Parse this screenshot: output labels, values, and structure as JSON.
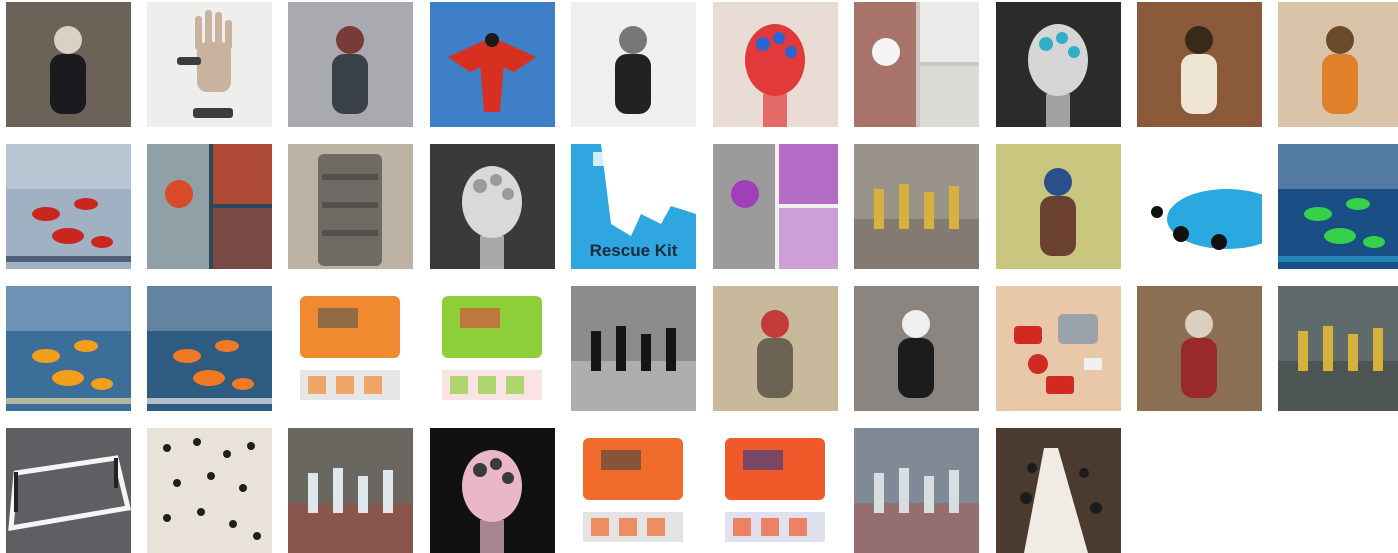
{
  "gallery": {
    "tiles": [
      {
        "name": "tile-figure-forest-headdress",
        "bg": "#6d6258",
        "fg": "#1b1b1f",
        "accent": "#d9d2c4",
        "motif": "figure"
      },
      {
        "name": "tile-hand-prosthetic-glove",
        "bg": "#eeeeec",
        "fg": "#c9b39e",
        "accent": "#3c3c3c",
        "motif": "hand"
      },
      {
        "name": "tile-person-wearable-chair-stadium",
        "bg": "#a8aab0",
        "fg": "#3a4048",
        "accent": "#7a3a3a",
        "motif": "figure"
      },
      {
        "name": "tile-wingsuit-flyer-sky",
        "bg": "#3f7fc8",
        "fg": "#d83020",
        "accent": "#1a1a1a",
        "motif": "wing"
      },
      {
        "name": "tile-person-walking-stilts",
        "bg": "#efefef",
        "fg": "#222222",
        "accent": "#777777",
        "motif": "figure"
      },
      {
        "name": "tile-head-with-balls-helmet",
        "bg": "#e8dcd4",
        "fg": "#e23a3a",
        "accent": "#2a66d1",
        "motif": "head"
      },
      {
        "name": "tile-white-outfit-collage",
        "bg": "#cbc6c0",
        "fg": "#f5f5f5",
        "accent": "#8a2f22",
        "motif": "collage"
      },
      {
        "name": "tile-mannequin-head-tubes",
        "bg": "#2b2b2b",
        "fg": "#d6d6d6",
        "accent": "#2fb0c8",
        "motif": "head"
      },
      {
        "name": "tile-person-fan-headpiece",
        "bg": "#8a5a3a",
        "fg": "#efe6d4",
        "accent": "#3a2a1a",
        "motif": "figure"
      },
      {
        "name": "tile-inflatable-orange-costume",
        "bg": "#d9c3a9",
        "fg": "#e0802a",
        "accent": "#6a4a2a",
        "motif": "figure"
      },
      {
        "name": "tile-sea-rescue-boat",
        "bg": "#9fb1c2",
        "fg": "#c9261f",
        "accent": "#2b3e55",
        "motif": "sea"
      },
      {
        "name": "tile-dual-photo-masked-people",
        "bg": "#2a4a5a",
        "fg": "#d94a2a",
        "accent": "#e6e6e6",
        "motif": "collage"
      },
      {
        "name": "tile-hands-folded-fabric-panel",
        "bg": "#bdb3a5",
        "fg": "#6f6a63",
        "accent": "#2b2b2b",
        "motif": "fabric"
      },
      {
        "name": "tile-astronaut-helmet-archive",
        "bg": "#3a3a3a",
        "fg": "#d9d9d9",
        "accent": "#9a9a9a",
        "motif": "head"
      },
      {
        "name": "tile-rescue-kit-map-cover",
        "bg": "#2fa6e0",
        "fg": "#ffffff",
        "accent": "#1a2b3a",
        "motif": "map",
        "caption_key": "rescue_kit"
      },
      {
        "name": "tile-inflatable-diagram-collage",
        "bg": "#f0f0f0",
        "fg": "#a03fb8",
        "accent": "#555555",
        "motif": "collage"
      },
      {
        "name": "tile-gold-object-street",
        "bg": "#9a9389",
        "fg": "#d7b040",
        "accent": "#5a5148",
        "motif": "street"
      },
      {
        "name": "tile-man-with-tall-sculpture",
        "bg": "#c9c77f",
        "fg": "#6a4030",
        "accent": "#2c4f8a",
        "motif": "figure"
      },
      {
        "name": "tile-silhouettes-blue-disc",
        "bg": "#ffffff",
        "fg": "#2aa8e0",
        "accent": "#111111",
        "motif": "disc"
      },
      {
        "name": "tile-green-pod-underwater",
        "bg": "#1a4f86",
        "fg": "#36d14a",
        "accent": "#25a0d0",
        "motif": "sea"
      },
      {
        "name": "tile-orange-buoys-sea",
        "bg": "#3b6f9a",
        "fg": "#f2a01c",
        "accent": "#e9d7a0",
        "motif": "sea"
      },
      {
        "name": "tile-orange-life-raft",
        "bg": "#2e5b80",
        "fg": "#f07a24",
        "accent": "#e9e9e9",
        "motif": "sea"
      },
      {
        "name": "tile-assembly-instructions-sheet",
        "bg": "#ffffff",
        "fg": "#f08a30",
        "accent": "#555555",
        "motif": "sheet"
      },
      {
        "name": "tile-pump-and-jump-sheet",
        "bg": "#ffffff",
        "fg": "#8fd03a",
        "accent": "#e04040",
        "motif": "sheet"
      },
      {
        "name": "tile-row-of-figures-bw",
        "bg": "#8c8c8c",
        "fg": "#151515",
        "accent": "#efefef",
        "motif": "street"
      },
      {
        "name": "tile-man-with-vest-mask",
        "bg": "#c8b89c",
        "fg": "#6d6353",
        "accent": "#c23a3a",
        "motif": "figure"
      },
      {
        "name": "tile-woman-with-breathing-tube",
        "bg": "#8a8580",
        "fg": "#1c1c1c",
        "accent": "#f0f0f0",
        "motif": "figure"
      },
      {
        "name": "tile-red-tin-survival-kit",
        "bg": "#e8c8a8",
        "fg": "#d02a22",
        "accent": "#9aa2aa",
        "motif": "kit"
      },
      {
        "name": "tile-robed-figure-warehouse",
        "bg": "#8a6f52",
        "fg": "#9a2a2a",
        "accent": "#d9d0c0",
        "motif": "figure"
      },
      {
        "name": "tile-yellow-suits-street",
        "bg": "#5f6a6a",
        "fg": "#d7b23a",
        "accent": "#2a2a2a",
        "motif": "street"
      },
      {
        "name": "tile-white-frame-asphalt",
        "bg": "#5e5f62",
        "fg": "#f5f5f5",
        "accent": "#222222",
        "motif": "frame"
      },
      {
        "name": "tile-crowd-under-white-sheet",
        "bg": "#e8e2d8",
        "fg": "#1e1e1e",
        "accent": "#cfc6b8",
        "motif": "crowd"
      },
      {
        "name": "tile-plastic-tunnel-street",
        "bg": "#6a6660",
        "fg": "#dfe6ec",
        "accent": "#c0392b",
        "motif": "street"
      },
      {
        "name": "tile-pink-inflated-head-suit",
        "bg": "#111111",
        "fg": "#e9b7c8",
        "accent": "#3a3a3a",
        "motif": "head"
      },
      {
        "name": "tile-orange-device-diagram",
        "bg": "#ffffff",
        "fg": "#f06a2a",
        "accent": "#444444",
        "motif": "sheet"
      },
      {
        "name": "tile-orange-kit-flatlay",
        "bg": "#ffffff",
        "fg": "#f05a2a",
        "accent": "#2a3a8a",
        "motif": "sheet"
      },
      {
        "name": "tile-city-road-aerial",
        "bg": "#7f8a96",
        "fg": "#d8dde2",
        "accent": "#c0392b",
        "motif": "street"
      },
      {
        "name": "tile-long-banquet-table",
        "bg": "#4a3a30",
        "fg": "#f0ece4",
        "accent": "#1c1c1c",
        "motif": "table"
      }
    ]
  },
  "captions": {
    "rescue_kit": "Rescue Kit"
  }
}
